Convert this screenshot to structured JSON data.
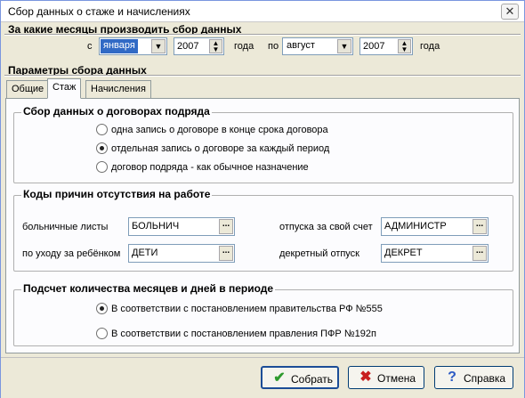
{
  "window": {
    "title": "Сбор данных о стаже и начислениях",
    "close_symbol": "✕"
  },
  "months_section": {
    "title": "За какие месяцы производить сбор данных",
    "from_label": "с",
    "from_month": "января",
    "from_year": "2007",
    "year_label_1": "года",
    "to_label": "по",
    "to_month": "август",
    "to_year": "2007",
    "year_label_2": "года"
  },
  "params_section": {
    "title": "Параметры сбора данных"
  },
  "tabs": [
    {
      "label": "Общие",
      "active": false
    },
    {
      "label": "Стаж",
      "active": true
    },
    {
      "label": "Начисления",
      "active": false
    }
  ],
  "contracts_group": {
    "title": "Сбор данных о договорах подряда",
    "options": [
      {
        "label": "одна запись о договоре в конце срока договора",
        "checked": false
      },
      {
        "label": "отдельная запись о договоре за каждый период",
        "checked": true
      },
      {
        "label": "договор подряда - как обычное назначение",
        "checked": false
      }
    ]
  },
  "absence_group": {
    "title": "Коды причин отсутствия на работе",
    "sick_label": "больничные листы",
    "sick_value": "БОЛЬНИЧ",
    "vacation_label": "отпуска за свой счет",
    "vacation_value": "АДМИНИСТР",
    "childcare_label": "по уходу за ребёнком",
    "childcare_value": "ДЕТИ",
    "maternity_label": "декретный отпуск",
    "maternity_value": "ДЕКРЕТ",
    "dots": "..."
  },
  "count_group": {
    "title": "Подсчет количества месяцев и дней в периоде",
    "options": [
      {
        "label": "В соответствии с постановлением правительства РФ №555",
        "checked": true
      },
      {
        "label": "В соответствии с постановлением правления ПФР №192п",
        "checked": false
      }
    ]
  },
  "buttons": {
    "ok_label": "Собрать",
    "ok_icon": "✔",
    "cancel_label": "Отмена",
    "cancel_icon": "✖",
    "help_label": "Справка",
    "help_icon": "?"
  },
  "colors": {
    "ok_icon": "#2e9a2e",
    "cancel_icon": "#c81e1e",
    "help_icon": "#2d5bc4",
    "selection": "#316ac5"
  }
}
